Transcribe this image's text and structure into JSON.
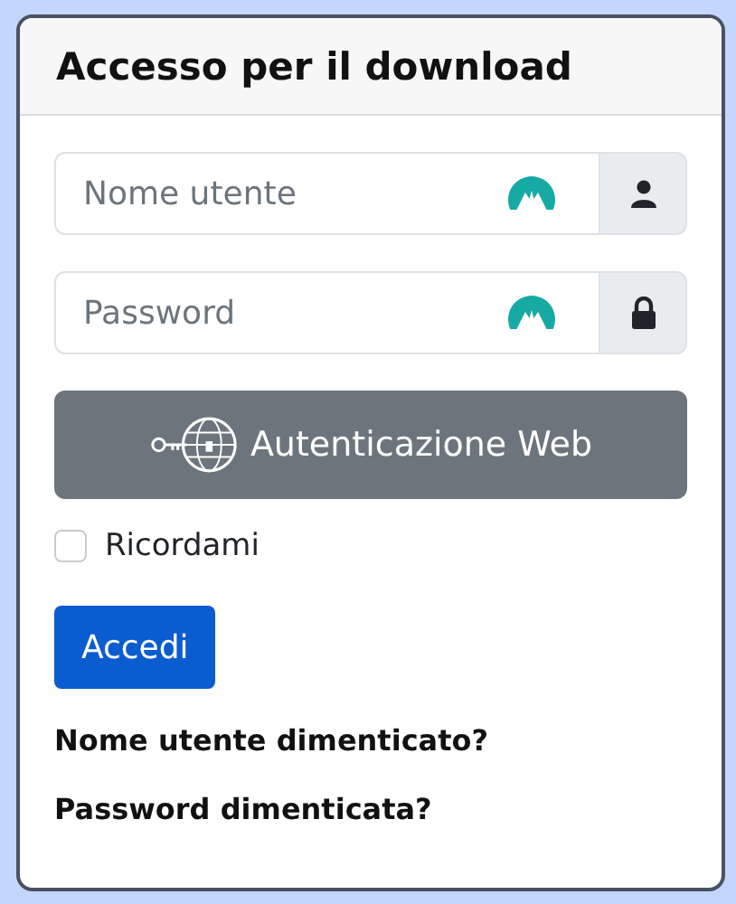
{
  "card": {
    "title": "Accesso per il download"
  },
  "fields": [
    {
      "placeholder": "Nome utente",
      "kind": "user"
    },
    {
      "placeholder": "Password",
      "kind": "lock"
    }
  ],
  "web_auth_button": "Autenticazione Web",
  "remember": {
    "label": "Ricordami",
    "checked": false
  },
  "submit_button": "Accedi",
  "links": [
    "Nome utente dimenticato?",
    "Password dimenticata?"
  ]
}
